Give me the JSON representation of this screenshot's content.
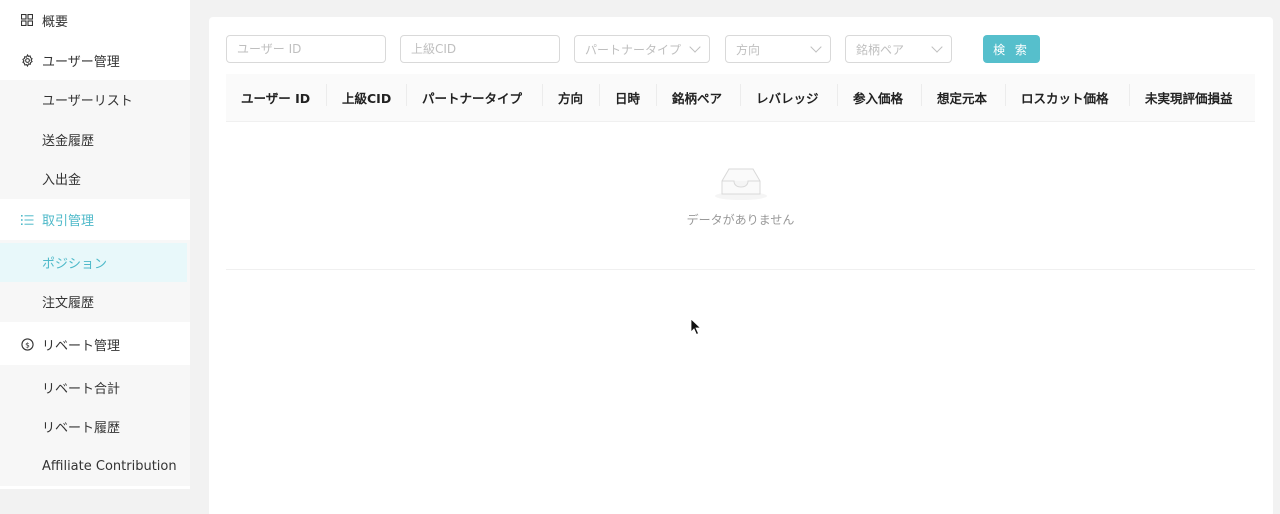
{
  "sidebar": {
    "overview": "概要",
    "user_mgmt": {
      "label": "ユーザー管理",
      "items": [
        "ユーザーリスト",
        "送金履歴",
        "入出金"
      ]
    },
    "trade_mgmt": {
      "label": "取引管理",
      "items": [
        "ポジション",
        "注文履歴"
      ]
    },
    "rebate_mgmt": {
      "label": "リベート管理",
      "items": [
        "リベート合計",
        "リベート履歴",
        "Affiliate Contribution"
      ]
    },
    "active_item": "ポジション",
    "accent_color": "#4eb9c9"
  },
  "filters": {
    "user_id_placeholder": "ユーザー ID",
    "upper_cid_placeholder": "上級CID",
    "partner_type_placeholder": "パートナータイプ",
    "direction_placeholder": "方向",
    "pair_placeholder": "銘柄ペア",
    "search_label": "検 索"
  },
  "table": {
    "columns": [
      "ユーザー ID",
      "上級CID",
      "パートナータイプ",
      "方向",
      "日時",
      "銘柄ペア",
      "レバレッジ",
      "参入価格",
      "想定元本",
      "ロスカット価格",
      "未実現評価損益"
    ],
    "empty_text": "データがありません"
  }
}
